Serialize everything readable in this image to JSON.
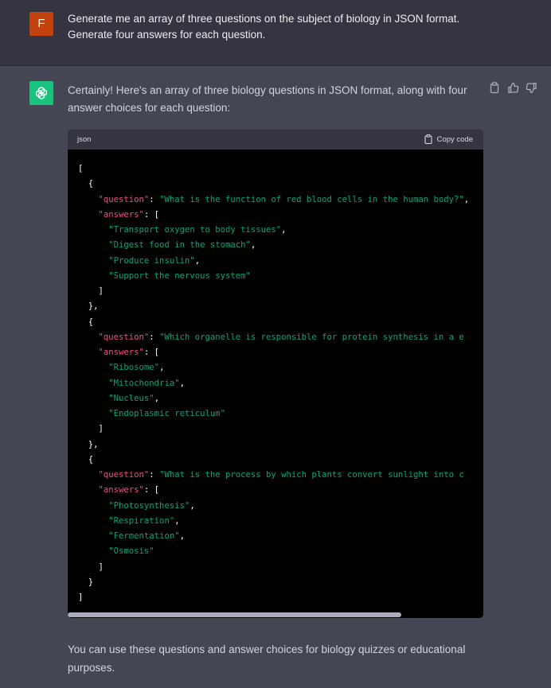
{
  "user_message": {
    "avatar_letter": "F",
    "text": "Generate me an array of three questions on the subject of biology in JSON format. Generate four answers for each question."
  },
  "assistant_message": {
    "intro": "Certainly! Here's an array of three biology questions in JSON format, along with four answer choices for each question:",
    "outro": "You can use these questions and answer choices for biology quizzes or educational purposes.",
    "actions": [
      "copy-icon",
      "thumbs-up-icon",
      "thumbs-down-icon"
    ]
  },
  "code_block": {
    "language": "json",
    "copy_label": "Copy code",
    "lines": [
      [
        {
          "t": "p",
          "v": "["
        }
      ],
      [
        {
          "t": "p",
          "v": "  {"
        }
      ],
      [
        {
          "t": "p",
          "v": "    "
        },
        {
          "t": "key",
          "v": "\"question\""
        },
        {
          "t": "p",
          "v": ": "
        },
        {
          "t": "str",
          "v": "\"What is the function of red blood cells in the human body?\""
        },
        {
          "t": "p",
          "v": ","
        }
      ],
      [
        {
          "t": "p",
          "v": "    "
        },
        {
          "t": "key",
          "v": "\"answers\""
        },
        {
          "t": "p",
          "v": ": ["
        }
      ],
      [
        {
          "t": "p",
          "v": "      "
        },
        {
          "t": "str",
          "v": "\"Transport oxygen to body tissues\""
        },
        {
          "t": "p",
          "v": ","
        }
      ],
      [
        {
          "t": "p",
          "v": "      "
        },
        {
          "t": "str",
          "v": "\"Digest food in the stomach\""
        },
        {
          "t": "p",
          "v": ","
        }
      ],
      [
        {
          "t": "p",
          "v": "      "
        },
        {
          "t": "str",
          "v": "\"Produce insulin\""
        },
        {
          "t": "p",
          "v": ","
        }
      ],
      [
        {
          "t": "p",
          "v": "      "
        },
        {
          "t": "str",
          "v": "\"Support the nervous system\""
        }
      ],
      [
        {
          "t": "p",
          "v": "    ]"
        }
      ],
      [
        {
          "t": "p",
          "v": "  },"
        }
      ],
      [
        {
          "t": "p",
          "v": "  {"
        }
      ],
      [
        {
          "t": "p",
          "v": "    "
        },
        {
          "t": "key",
          "v": "\"question\""
        },
        {
          "t": "p",
          "v": ": "
        },
        {
          "t": "str",
          "v": "\"Which organelle is responsible for protein synthesis in a e"
        }
      ],
      [
        {
          "t": "p",
          "v": "    "
        },
        {
          "t": "key",
          "v": "\"answers\""
        },
        {
          "t": "p",
          "v": ": ["
        }
      ],
      [
        {
          "t": "p",
          "v": "      "
        },
        {
          "t": "str",
          "v": "\"Ribosome\""
        },
        {
          "t": "p",
          "v": ","
        }
      ],
      [
        {
          "t": "p",
          "v": "      "
        },
        {
          "t": "str",
          "v": "\"Mitochondria\""
        },
        {
          "t": "p",
          "v": ","
        }
      ],
      [
        {
          "t": "p",
          "v": "      "
        },
        {
          "t": "str",
          "v": "\"Nucleus\""
        },
        {
          "t": "p",
          "v": ","
        }
      ],
      [
        {
          "t": "p",
          "v": "      "
        },
        {
          "t": "str",
          "v": "\"Endoplasmic reticulum\""
        }
      ],
      [
        {
          "t": "p",
          "v": "    ]"
        }
      ],
      [
        {
          "t": "p",
          "v": "  },"
        }
      ],
      [
        {
          "t": "p",
          "v": "  {"
        }
      ],
      [
        {
          "t": "p",
          "v": "    "
        },
        {
          "t": "key",
          "v": "\"question\""
        },
        {
          "t": "p",
          "v": ": "
        },
        {
          "t": "str",
          "v": "\"What is the process by which plants convert sunlight into c"
        }
      ],
      [
        {
          "t": "p",
          "v": "    "
        },
        {
          "t": "key",
          "v": "\"answers\""
        },
        {
          "t": "p",
          "v": ": ["
        }
      ],
      [
        {
          "t": "p",
          "v": "      "
        },
        {
          "t": "str",
          "v": "\"Photosynthesis\""
        },
        {
          "t": "p",
          "v": ","
        }
      ],
      [
        {
          "t": "p",
          "v": "      "
        },
        {
          "t": "str",
          "v": "\"Respiration\""
        },
        {
          "t": "p",
          "v": ","
        }
      ],
      [
        {
          "t": "p",
          "v": "      "
        },
        {
          "t": "str",
          "v": "\"Fermentation\""
        },
        {
          "t": "p",
          "v": ","
        }
      ],
      [
        {
          "t": "p",
          "v": "      "
        },
        {
          "t": "str",
          "v": "\"Osmosis\""
        }
      ],
      [
        {
          "t": "p",
          "v": "    ]"
        }
      ],
      [
        {
          "t": "p",
          "v": "  }"
        }
      ],
      [
        {
          "t": "p",
          "v": "]"
        }
      ]
    ]
  },
  "colors": {
    "user_bg": "#343541",
    "assistant_bg": "#444654",
    "user_avatar": "#c2410c",
    "bot_avatar": "#19c37d",
    "json_key": "#ef4f81",
    "json_string": "#00a67d"
  }
}
